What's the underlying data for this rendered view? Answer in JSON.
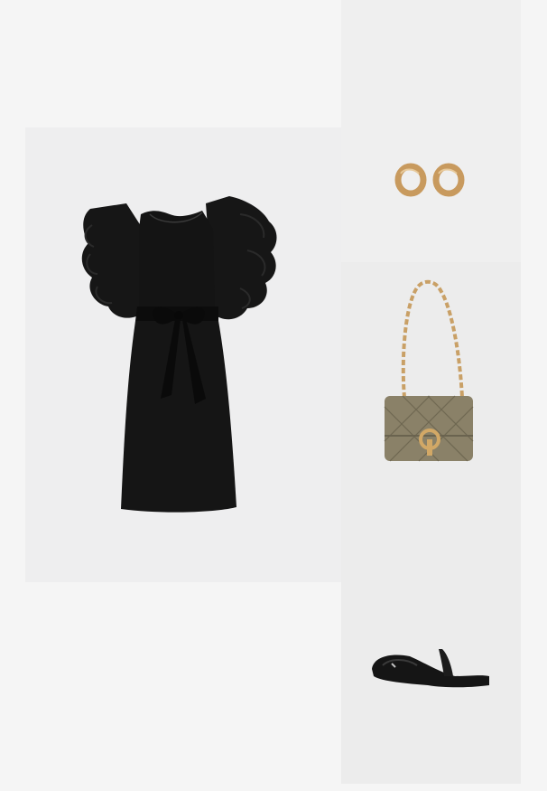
{
  "outfit": {
    "items": [
      {
        "name": "dress",
        "color": "#111111"
      },
      {
        "name": "earrings",
        "color": "#c89a5e"
      },
      {
        "name": "shoulder-bag",
        "color": "#8a8168"
      },
      {
        "name": "mules",
        "color": "#151515"
      }
    ]
  }
}
